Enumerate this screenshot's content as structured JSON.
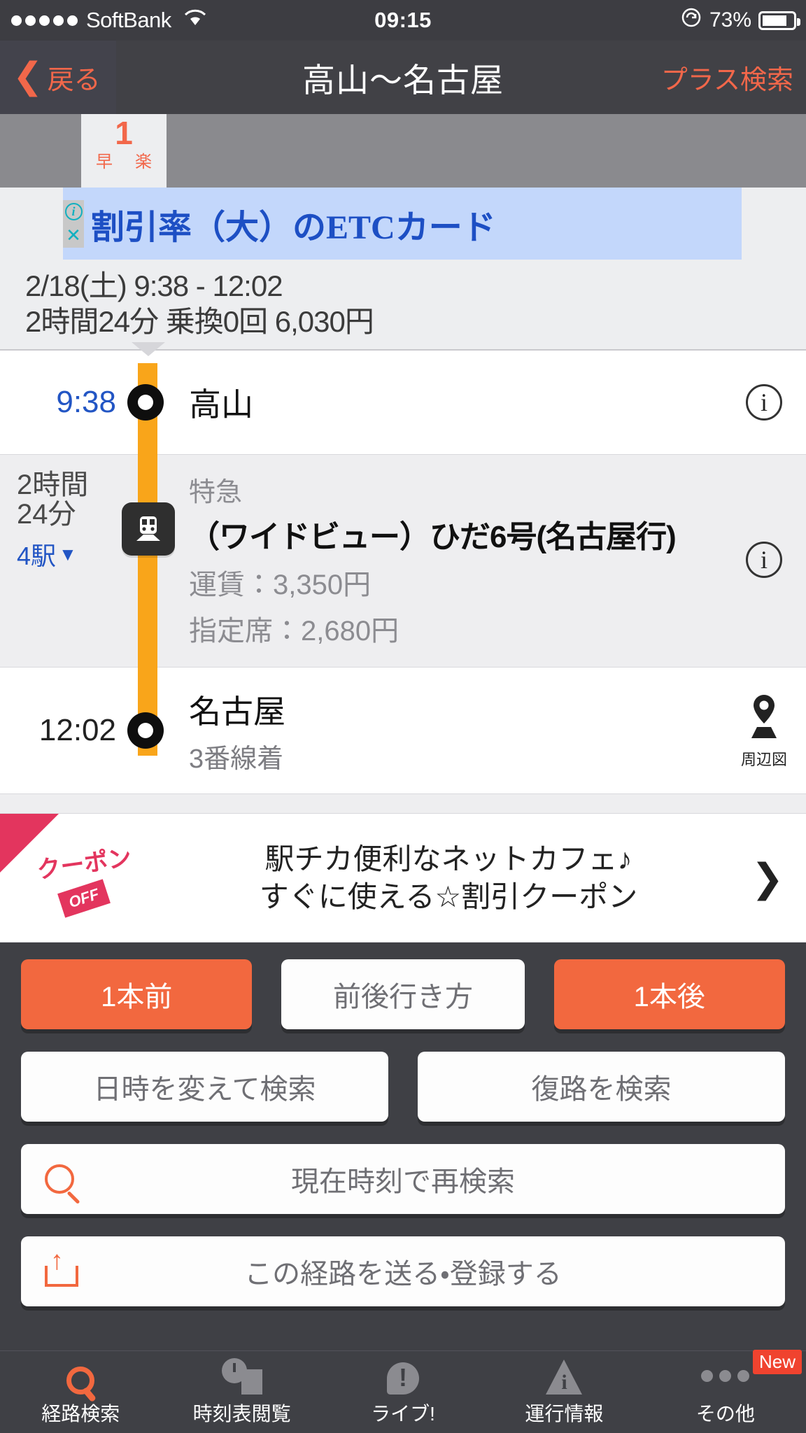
{
  "statusbar": {
    "carrier": "SoftBank",
    "wifi_icon": "wifi-icon",
    "time": "09:15",
    "lock_icon": "rotation-lock-icon",
    "battery_pct": "73%"
  },
  "navbar": {
    "back_label": "戻る",
    "back_icon": "chevron-left-icon",
    "title": "高山〜名古屋",
    "right_action": "プラス検索"
  },
  "tabstrip": {
    "tabs": [
      {
        "number": "1",
        "labels": [
          "早",
          "楽"
        ],
        "selected": true
      }
    ]
  },
  "ad": {
    "info_icon": "info-icon",
    "close_icon": "close-icon",
    "text": "割引率（大）のETCカード",
    "bg_color": "#c3d7fb",
    "text_color": "#1d4fc4"
  },
  "summary": {
    "line1": "2/18(土)  9:38 - 12:02",
    "line2": "2時間24分 乗換0回 6,030円"
  },
  "route": {
    "departure": {
      "time": "9:38",
      "station": "高山",
      "info_icon": "info-icon"
    },
    "segment": {
      "duration_line1": "2時間",
      "duration_line2": "24分",
      "stations_link": "4駅",
      "stations_caret": "▼",
      "train_icon": "train-icon",
      "kind": "特急",
      "train_name": "（ワイドビュー）ひだ6号(名古屋行)",
      "fare": "運賃：3,350円",
      "seat_fare": "指定席：2,680円",
      "info_icon": "info-icon"
    },
    "arrival": {
      "time": "12:02",
      "station": "名古屋",
      "platform": "3番線着",
      "map_icon": "map-pin-icon",
      "map_label": "周辺図"
    },
    "rail_color": "#f9a51a"
  },
  "coupon": {
    "badge_label": "クーポン",
    "off_tag": "OFF",
    "text_line1": "駅チカ便利なネットカフェ♪",
    "text_line2": "すぐに使える☆割引クーポン",
    "arrow_icon": "chevron-right-icon",
    "accent_color": "#e3355e"
  },
  "actions": {
    "row1": [
      {
        "label": "1本前",
        "style": "orange"
      },
      {
        "label": "前後行き方",
        "style": "white"
      },
      {
        "label": "1本後",
        "style": "orange"
      }
    ],
    "row2": [
      {
        "label": "日時を変えて検索",
        "style": "white"
      },
      {
        "label": "復路を検索",
        "style": "white"
      }
    ],
    "row3": {
      "label": "現在時刻で再検索",
      "icon": "search-icon",
      "style": "white"
    },
    "row4": {
      "label": "この経路を送る・登録する",
      "icon": "share-icon",
      "style": "white"
    }
  },
  "tabbar": {
    "items": [
      {
        "label": "経路検索",
        "icon": "search-icon",
        "active": true,
        "badge": ""
      },
      {
        "label": "時刻表閲覧",
        "icon": "timetable-icon",
        "active": false,
        "badge": ""
      },
      {
        "label": "ライブ!",
        "icon": "speech-bubble-alert-icon",
        "active": false,
        "badge": ""
      },
      {
        "label": "運行情報",
        "icon": "warning-triangle-icon",
        "active": false,
        "badge": ""
      },
      {
        "label": "その他",
        "icon": "ellipsis-icon",
        "active": false,
        "badge": "New"
      }
    ]
  }
}
